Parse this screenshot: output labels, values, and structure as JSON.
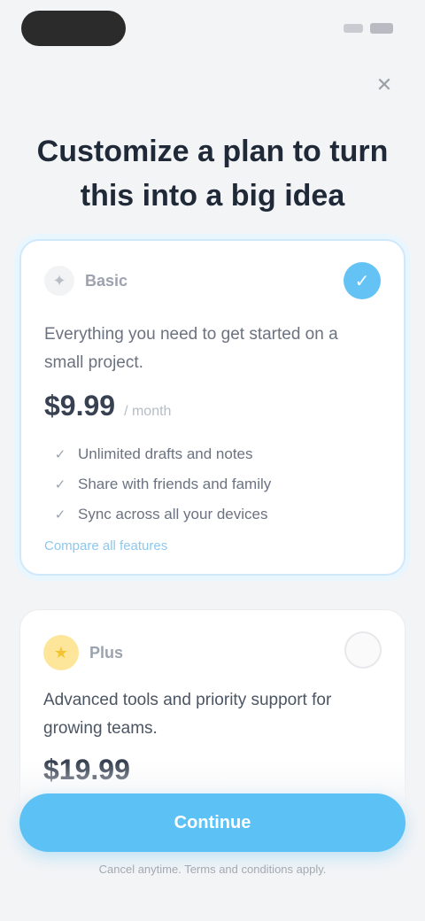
{
  "status_bar": {},
  "header": {
    "close_symbol": "✕",
    "title": "Customize a plan to turn this into a big idea"
  },
  "plans": [
    {
      "icon": "✦",
      "name": "Basic",
      "description": "Everything you need to get started on a small project.",
      "price": "$9.99",
      "period": "/ month",
      "features": [
        "Unlimited drafts and notes",
        "Share with friends and family",
        "Sync across all your devices"
      ],
      "more_link": "Compare all features",
      "selected": true,
      "radio_symbol": "✓"
    },
    {
      "icon": "★",
      "name": "Plus",
      "description": "Advanced tools and priority support for growing teams.",
      "price": "$19.99",
      "selected": false
    }
  ],
  "cta": {
    "label": "Continue"
  },
  "fine_print": "Cancel anytime. Terms and conditions apply.",
  "colors": {
    "accent": "#5cc2f5",
    "plus_badge": "#fde59a",
    "background": "#f3f4f6"
  }
}
